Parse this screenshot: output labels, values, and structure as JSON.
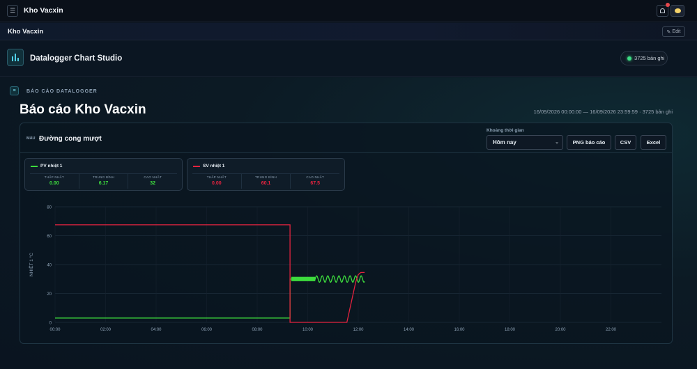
{
  "topbar": {
    "menu_glyph": "☰",
    "title": "Kho Vacxin",
    "bell_glyph": "🔔"
  },
  "subbar": {
    "title": "Kho Vacxin",
    "edit_label": "Edit",
    "edit_glyph": "✎"
  },
  "studio": {
    "title": "Datalogger Chart Studio",
    "records": "3725 bản ghi"
  },
  "report": {
    "icon_glyph": "≡",
    "kicker": "BÁO CÁO DATALOGGER",
    "title": "Báo cáo Kho Vacxin",
    "range": "16/09/2026 00:00:00 — 16/09/2026 23:59:59 · 3725 bản ghi"
  },
  "card": {
    "style_kicker": "MẪU",
    "style_name": "Đường cong mượt",
    "period_label": "Khoảng thời gian",
    "period_value": "Hôm nay",
    "buttons": {
      "png": "PNG báo cáo",
      "csv": "CSV",
      "excel": "Excel"
    }
  },
  "stats": [
    {
      "name": "PV nhiệt 1",
      "color": "#3ddc3d",
      "min_label": "THẤP NHẤT",
      "min": "0.00",
      "avg_label": "TRUNG BÌNH",
      "avg": "6.17",
      "max_label": "CAO NHẤT",
      "max": "32"
    },
    {
      "name": "SV nhiệt 1",
      "color": "#e5233f",
      "min_label": "THẤP NHẤT",
      "min": "0.00",
      "avg_label": "TRUNG BÌNH",
      "avg": "60.1",
      "max_label": "CAO NHẤT",
      "max": "67.5"
    }
  ],
  "colors": {
    "accent": "#4fd1e8",
    "pv": "#3ddc3d",
    "sv": "#e5233f"
  },
  "chart_data": {
    "type": "line",
    "ylabel": "NHIỆT 1 °C",
    "ylim": [
      0,
      80
    ],
    "yticks": [
      0,
      20,
      40,
      60,
      80
    ],
    "xlim": [
      0,
      24
    ],
    "xticks": [
      "00:00",
      "02:00",
      "04:00",
      "06:00",
      "08:00",
      "10:00",
      "12:00",
      "14:00",
      "16:00",
      "18:00",
      "20:00",
      "22:00"
    ],
    "grid": true,
    "series": [
      {
        "name": "PV nhiệt 1",
        "color": "#3ddc3d",
        "points": [
          [
            0,
            3
          ],
          [
            9.3,
            3
          ],
          [
            9.3,
            30
          ],
          [
            10.3,
            30
          ],
          [
            12.25,
            30
          ]
        ],
        "dense_oscillation": {
          "from": 9.35,
          "to": 10.3,
          "center": 30,
          "amplitude": 1.5
        },
        "wave": {
          "from": 10.3,
          "to": 12.25,
          "center": 30,
          "amplitude": 2.2,
          "period": 0.22
        }
      },
      {
        "name": "SV nhiệt 1",
        "color": "#e5233f",
        "points": [
          [
            0,
            67.5
          ],
          [
            9.3,
            67.5
          ],
          [
            9.3,
            0
          ],
          [
            11.55,
            0
          ],
          [
            11.9,
            28
          ],
          [
            12.0,
            33
          ],
          [
            12.1,
            34.5
          ],
          [
            12.25,
            34.5
          ]
        ]
      }
    ]
  }
}
